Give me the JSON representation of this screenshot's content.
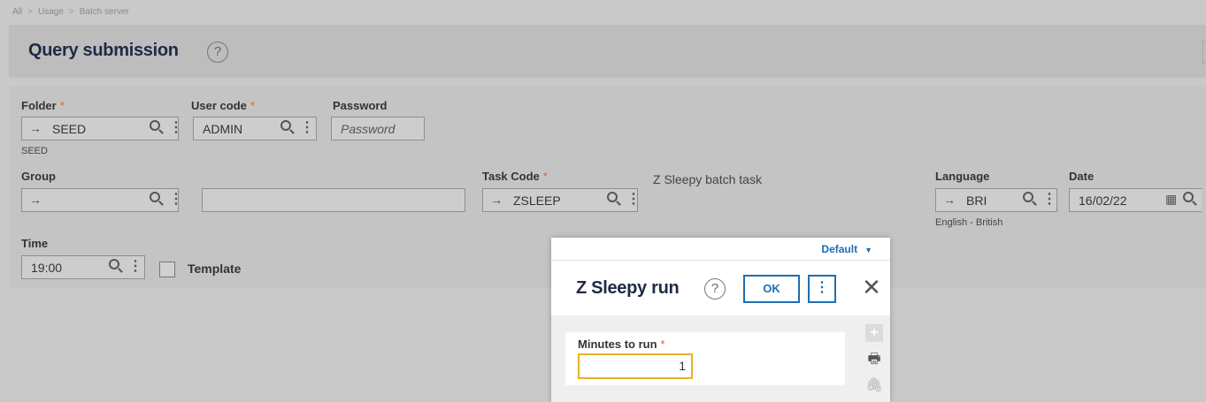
{
  "breadcrumb": [
    "All",
    "Usage",
    "Batch server"
  ],
  "page_title": "Query submission",
  "form": {
    "folder": {
      "label": "Folder",
      "value": "SEED",
      "sub": "SEED"
    },
    "user_code": {
      "label": "User code",
      "value": "ADMIN"
    },
    "password": {
      "label": "Password",
      "placeholder": "Password"
    },
    "group": {
      "label": "Group",
      "value": ""
    },
    "task_code": {
      "label": "Task Code",
      "value": "ZSLEEP",
      "description": "Z Sleepy batch task"
    },
    "language": {
      "label": "Language",
      "value": "BRI",
      "sub": "English - British"
    },
    "date": {
      "label": "Date",
      "value": "16/02/22"
    },
    "time": {
      "label": "Time",
      "value": "19:00"
    },
    "template": {
      "label": "Template"
    }
  },
  "dialog": {
    "default_label": "Default",
    "title": "Z Sleepy run",
    "ok_label": "OK",
    "minutes": {
      "label": "Minutes to run",
      "value": "1"
    }
  },
  "colors": {
    "accent": "#1c6fb4",
    "required": "#d9662e",
    "focus": "#e8b228"
  }
}
